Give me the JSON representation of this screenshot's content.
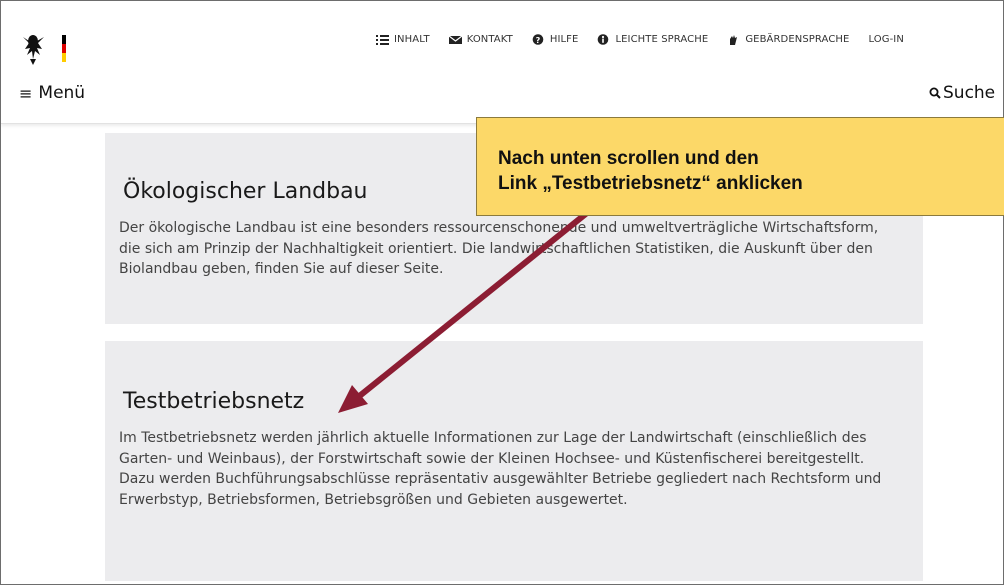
{
  "header": {
    "logo": "bundesadler-logo",
    "topnav": [
      {
        "label": "INHALT",
        "icon": "list-icon"
      },
      {
        "label": "KONTAKT",
        "icon": "envelope-icon"
      },
      {
        "label": "HILFE",
        "icon": "question-icon"
      },
      {
        "label": "LEICHTE SPRACHE",
        "icon": "leichte-sprache-icon"
      },
      {
        "label": "GEBÄRDENSPRACHE",
        "icon": "hand-icon"
      },
      {
        "label": "LOG-IN",
        "icon": ""
      }
    ],
    "menu_label": "Menü",
    "search_label": "Suche"
  },
  "teasers": [
    {
      "title": "Ökologischer Landbau",
      "text": "Der ökologische Landbau ist eine besonders ressourcenschonende und umweltverträgliche Wirtschaftsform, die sich am Prinzip der Nachhaltigkeit orientiert. Die landwirtschaftlichen Statistiken, die Auskunft über den Biolandbau geben, finden Sie auf dieser Seite."
    },
    {
      "title": "Testbetriebsnetz",
      "text": "Im Testbetriebsnetz werden jährlich aktuelle Informationen zur Lage der Landwirtschaft (einschließlich des Garten- und Weinbaus), der Forstwirtschaft sowie der Kleinen Hochsee- und Küstenfischerei bereitgestellt. Dazu werden Buchführungsabschlüsse repräsentativ ausgewählter Betriebe gegliedert nach Rechtsform und Erwerbstyp, Betriebsformen, Betriebsgrößen und Gebieten ausgewertet."
    }
  ],
  "callout": {
    "line1": "Nach unten scrollen und den",
    "line2": "Link „Testbetriebsnetz“ anklicken"
  },
  "colors": {
    "callout": "#fcd868",
    "arrow": "#8c1d33",
    "teaser_bg": "#ececee"
  }
}
